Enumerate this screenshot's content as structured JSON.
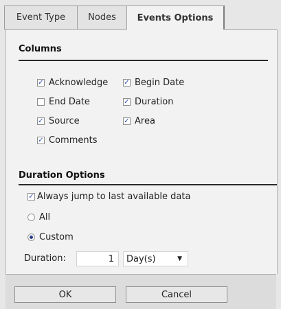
{
  "tabs": [
    {
      "label": "Event Type"
    },
    {
      "label": "Nodes"
    },
    {
      "label": "Events Options"
    }
  ],
  "columns": {
    "title": "Columns",
    "items": [
      {
        "label": "Acknowledge",
        "checked": true
      },
      {
        "label": "Begin Date",
        "checked": true
      },
      {
        "label": "End Date",
        "checked": false
      },
      {
        "label": "Duration",
        "checked": true
      },
      {
        "label": "Source",
        "checked": true
      },
      {
        "label": "Area",
        "checked": true
      },
      {
        "label": "Comments",
        "checked": true
      }
    ]
  },
  "duration_options": {
    "title": "Duration Options",
    "jump_label": "Always jump to last available data",
    "jump_checked": true,
    "all_label": "All",
    "custom_label": "Custom",
    "selected": "custom",
    "duration_label": "Duration:",
    "duration_value": "1",
    "unit_value": "Day(s)"
  },
  "buttons": {
    "ok": "OK",
    "cancel": "Cancel"
  },
  "colors": {
    "check": "#3452b0",
    "radio_dot": "#2a3f8c"
  },
  "icons": {
    "check": "✓",
    "dropdown": "▼"
  }
}
